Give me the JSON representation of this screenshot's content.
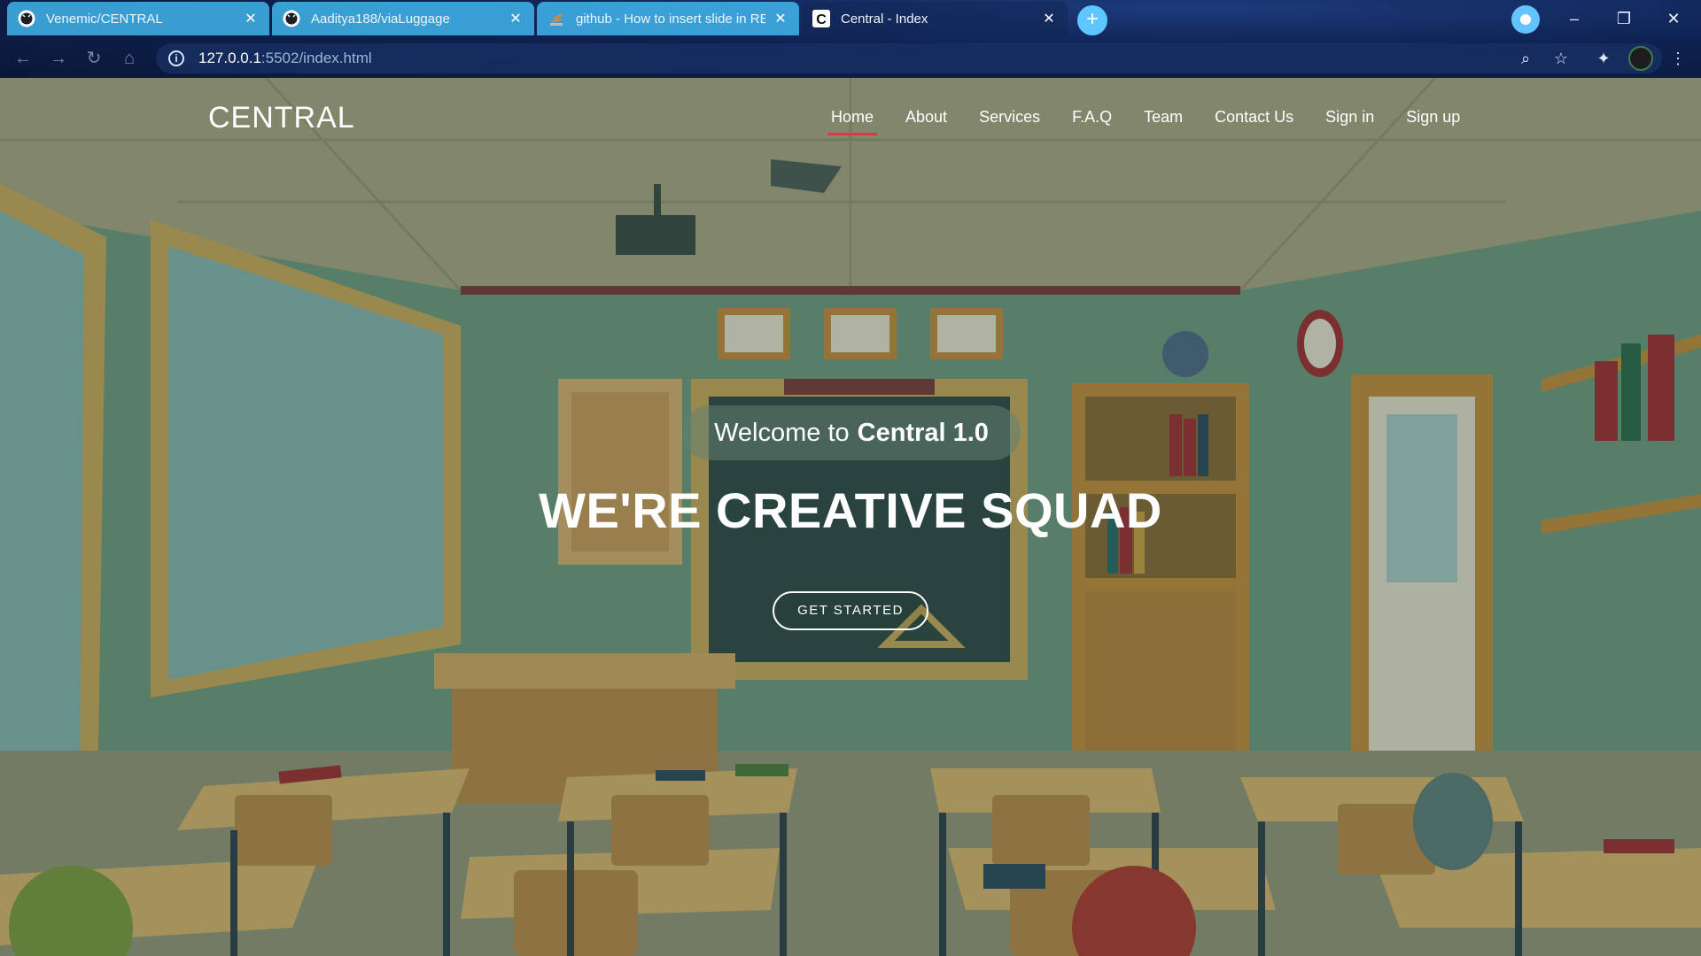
{
  "browser": {
    "tabs": [
      {
        "title": "Venemic/CENTRAL",
        "favicon": "github-icon",
        "active": false
      },
      {
        "title": "Aaditya188/viaLuggage",
        "favicon": "github-icon",
        "active": false
      },
      {
        "title": "github - How to insert slide in RE",
        "favicon": "stackoverflow-icon",
        "active": false
      },
      {
        "title": "Central - Index",
        "favicon": "central-c-icon",
        "active": true
      }
    ],
    "new_tab_label": "+",
    "url_host": "127.0.0.1",
    "url_rest": ":5502/index.html",
    "window_controls": {
      "minimize": "–",
      "restore": "❐",
      "close": "✕"
    },
    "tab_close": "✕",
    "nav_icons": {
      "back": "←",
      "forward": "→",
      "reload": "↻",
      "home": "⌂"
    },
    "toolbar_icons": {
      "zoom": "⌕",
      "bookmark": "☆",
      "extensions": "✦",
      "menu": "⋮"
    },
    "accent_inactive_tab": "#48c8ff"
  },
  "site": {
    "logo": "CENTRAL",
    "nav": [
      {
        "label": "Home",
        "active": true
      },
      {
        "label": "About",
        "active": false
      },
      {
        "label": "Services",
        "active": false
      },
      {
        "label": "F.A.Q",
        "active": false
      },
      {
        "label": "Team",
        "active": false
      },
      {
        "label": "Contact Us",
        "active": false
      },
      {
        "label": "Sign in",
        "active": false
      },
      {
        "label": "Sign up",
        "active": false
      }
    ],
    "active_underline_color": "#e8344a",
    "hero": {
      "welcome_prefix": "Welcome to",
      "welcome_brand": "Central 1.0",
      "headline": "WE'RE CREATIVE SQUAD",
      "cta": "GET STARTED"
    }
  }
}
